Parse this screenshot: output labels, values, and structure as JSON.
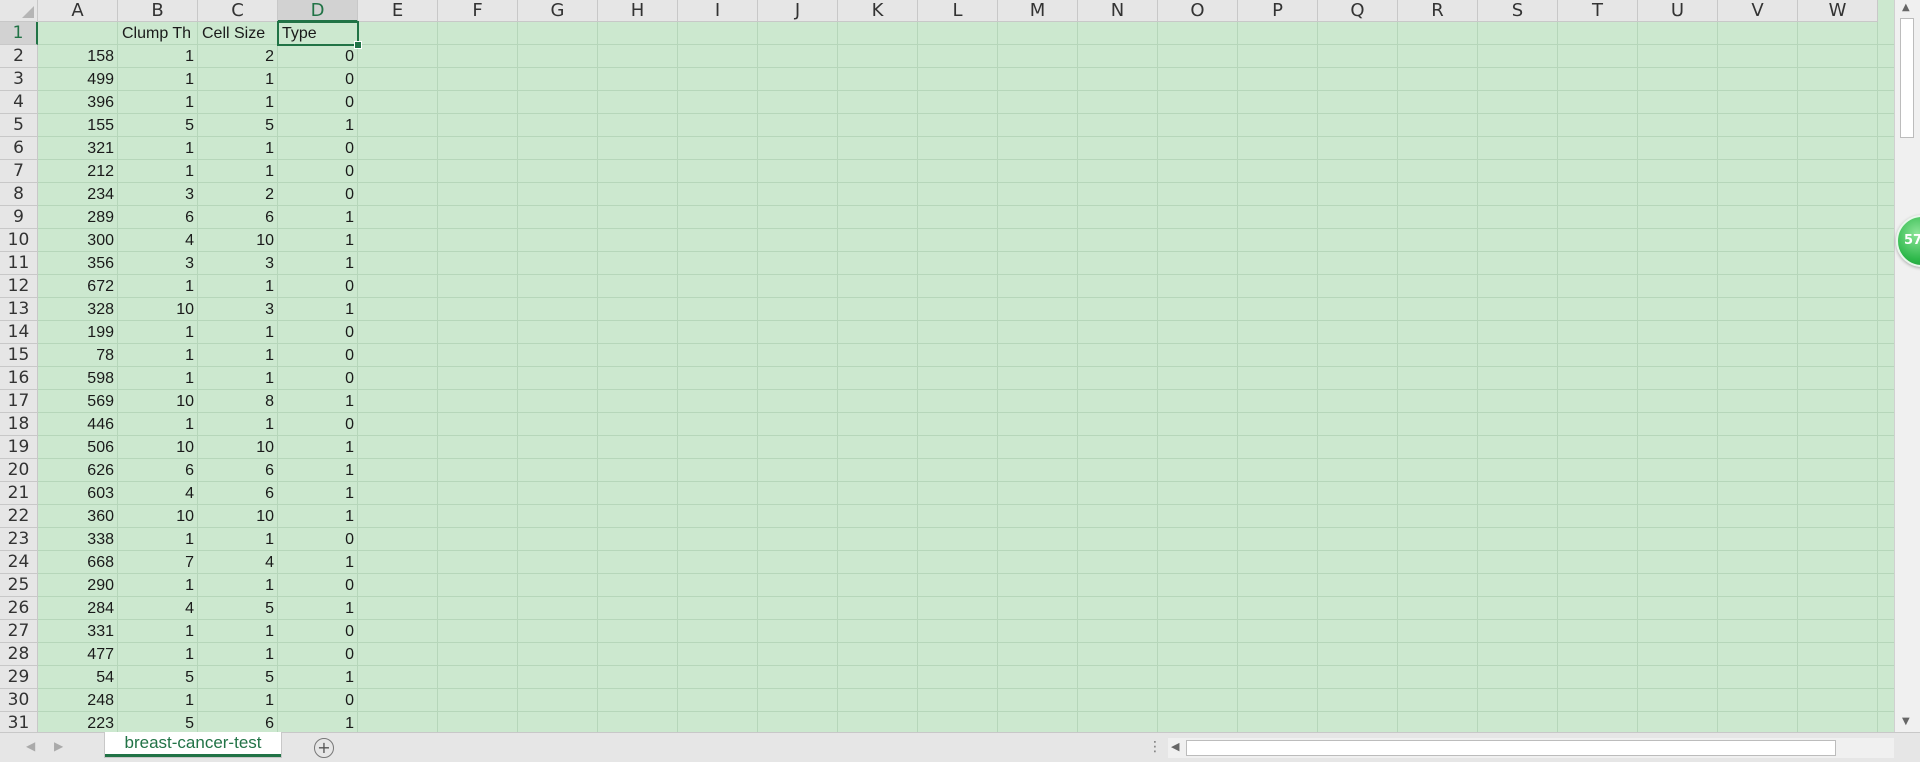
{
  "columns": [
    "A",
    "B",
    "C",
    "D",
    "E",
    "F",
    "G",
    "H",
    "I",
    "J",
    "K",
    "L",
    "M",
    "N",
    "O",
    "P",
    "Q",
    "R",
    "S",
    "T",
    "U",
    "V",
    "W"
  ],
  "selected_column": "D",
  "selected_row": 1,
  "headers": {
    "A": "",
    "B": "Clump Th",
    "C": "Cell Size",
    "D": "Type"
  },
  "rows": [
    [
      158,
      1,
      2,
      0
    ],
    [
      499,
      1,
      1,
      0
    ],
    [
      396,
      1,
      1,
      0
    ],
    [
      155,
      5,
      5,
      1
    ],
    [
      321,
      1,
      1,
      0
    ],
    [
      212,
      1,
      1,
      0
    ],
    [
      234,
      3,
      2,
      0
    ],
    [
      289,
      6,
      6,
      1
    ],
    [
      300,
      4,
      10,
      1
    ],
    [
      356,
      3,
      3,
      1
    ],
    [
      672,
      1,
      1,
      0
    ],
    [
      328,
      10,
      3,
      1
    ],
    [
      199,
      1,
      1,
      0
    ],
    [
      78,
      1,
      1,
      0
    ],
    [
      598,
      1,
      1,
      0
    ],
    [
      569,
      10,
      8,
      1
    ],
    [
      446,
      1,
      1,
      0
    ],
    [
      506,
      10,
      10,
      1
    ],
    [
      626,
      6,
      6,
      1
    ],
    [
      603,
      4,
      6,
      1
    ],
    [
      360,
      10,
      10,
      1
    ],
    [
      338,
      1,
      1,
      0
    ],
    [
      668,
      7,
      4,
      1
    ],
    [
      290,
      1,
      1,
      0
    ],
    [
      284,
      4,
      5,
      1
    ],
    [
      331,
      1,
      1,
      0
    ],
    [
      477,
      1,
      1,
      0
    ],
    [
      54,
      5,
      5,
      1
    ],
    [
      248,
      1,
      1,
      0
    ],
    [
      223,
      5,
      6,
      1
    ]
  ],
  "sheet_tab": "breast-cancer-test",
  "add_sheet_symbol": "+",
  "badge_text": "57",
  "colors": {
    "grid_bg": "#cce8cf",
    "accent": "#217346"
  }
}
